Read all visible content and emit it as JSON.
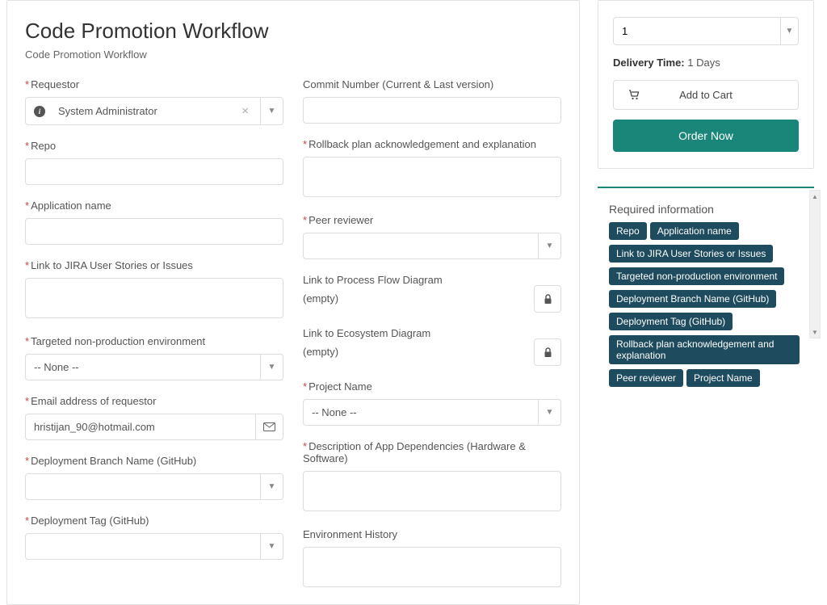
{
  "header": {
    "title": "Code Promotion Workflow",
    "subtitle": "Code Promotion Workflow"
  },
  "form": {
    "requestor": {
      "label": "Requestor",
      "value": "System Administrator",
      "required": true
    },
    "repo": {
      "label": "Repo",
      "value": "",
      "required": true
    },
    "application_name": {
      "label": "Application name",
      "value": "",
      "required": true
    },
    "jira_link": {
      "label": "Link to JIRA User Stories or Issues",
      "value": "",
      "required": true
    },
    "target_env": {
      "label": "Targeted non-production environment",
      "value": "-- None --",
      "required": true
    },
    "email": {
      "label": "Email address of requestor",
      "value": "hristijan_90@hotmail.com",
      "required": true
    },
    "branch": {
      "label": "Deployment Branch Name (GitHub)",
      "value": "",
      "required": true
    },
    "tag": {
      "label": "Deployment Tag (GitHub)",
      "value": "",
      "required": true
    },
    "commit": {
      "label": "Commit Number (Current & Last version)",
      "value": "",
      "required": false
    },
    "rollback": {
      "label": "Rollback plan acknowledgement and explanation",
      "value": "",
      "required": true
    },
    "peer": {
      "label": "Peer reviewer",
      "value": "",
      "required": true
    },
    "process_flow": {
      "label": "Link to Process Flow Diagram",
      "value": "(empty)"
    },
    "ecosystem": {
      "label": "Link to Ecosystem Diagram",
      "value": "(empty)"
    },
    "project": {
      "label": "Project Name",
      "value": "-- None --",
      "required": true
    },
    "dependencies": {
      "label": "Description of App Dependencies (Hardware & Software)",
      "value": "",
      "required": true
    },
    "env_history": {
      "label": "Environment History",
      "value": "",
      "required": false
    }
  },
  "cart": {
    "quantity": "1",
    "delivery_label": "Delivery Time:",
    "delivery_value": "1 Days",
    "add_label": "Add to Cart",
    "order_label": "Order Now"
  },
  "required_info": {
    "title": "Required information",
    "tags": [
      "Repo",
      "Application name",
      "Link to JIRA User Stories or Issues",
      "Targeted non-production environment",
      "Deployment Branch Name (GitHub)",
      "Deployment Tag (GitHub)",
      "Rollback plan acknowledgement and explanation",
      "Peer reviewer",
      "Project Name"
    ]
  }
}
